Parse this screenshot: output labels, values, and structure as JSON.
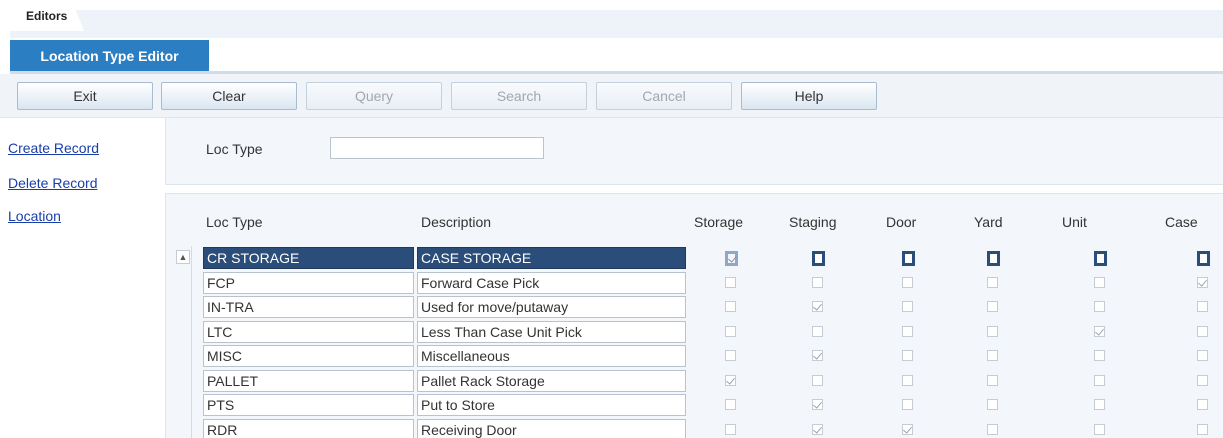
{
  "tabs": {
    "editors": "Editors",
    "editor_title": "Location Type Editor"
  },
  "toolbar": [
    {
      "label": "Exit",
      "enabled": true
    },
    {
      "label": "Clear",
      "enabled": true
    },
    {
      "label": "Query",
      "enabled": false
    },
    {
      "label": "Search",
      "enabled": false
    },
    {
      "label": "Cancel",
      "enabled": false
    },
    {
      "label": "Help",
      "enabled": true
    }
  ],
  "links": [
    "Create Record",
    "Delete Record",
    "Location"
  ],
  "query": {
    "loc_type_label": "Loc Type",
    "loc_type_value": ""
  },
  "table": {
    "columns": [
      "Loc Type",
      "Description",
      "Storage",
      "Staging",
      "Door",
      "Yard",
      "Unit",
      "Case"
    ],
    "rows": [
      {
        "type": "CR STORAGE",
        "desc": "CASE STORAGE",
        "flags": [
          true,
          false,
          false,
          false,
          false,
          false
        ],
        "selected": true
      },
      {
        "type": "FCP",
        "desc": "Forward Case Pick",
        "flags": [
          false,
          false,
          false,
          false,
          false,
          true
        ],
        "selected": false
      },
      {
        "type": "IN-TRA",
        "desc": "Used for move/putaway",
        "flags": [
          false,
          true,
          false,
          false,
          false,
          false
        ],
        "selected": false
      },
      {
        "type": "LTC",
        "desc": "Less Than Case Unit Pick",
        "flags": [
          false,
          false,
          false,
          false,
          true,
          false
        ],
        "selected": false
      },
      {
        "type": "MISC",
        "desc": "Miscellaneous",
        "flags": [
          false,
          true,
          false,
          false,
          false,
          false
        ],
        "selected": false
      },
      {
        "type": "PALLET",
        "desc": "Pallet Rack Storage",
        "flags": [
          true,
          false,
          false,
          false,
          false,
          false
        ],
        "selected": false
      },
      {
        "type": "PTS",
        "desc": "Put to Store",
        "flags": [
          false,
          true,
          false,
          false,
          false,
          false
        ],
        "selected": false
      },
      {
        "type": "RDR",
        "desc": "Receiving Door",
        "flags": [
          false,
          true,
          true,
          false,
          false,
          false
        ],
        "selected": false
      }
    ]
  }
}
